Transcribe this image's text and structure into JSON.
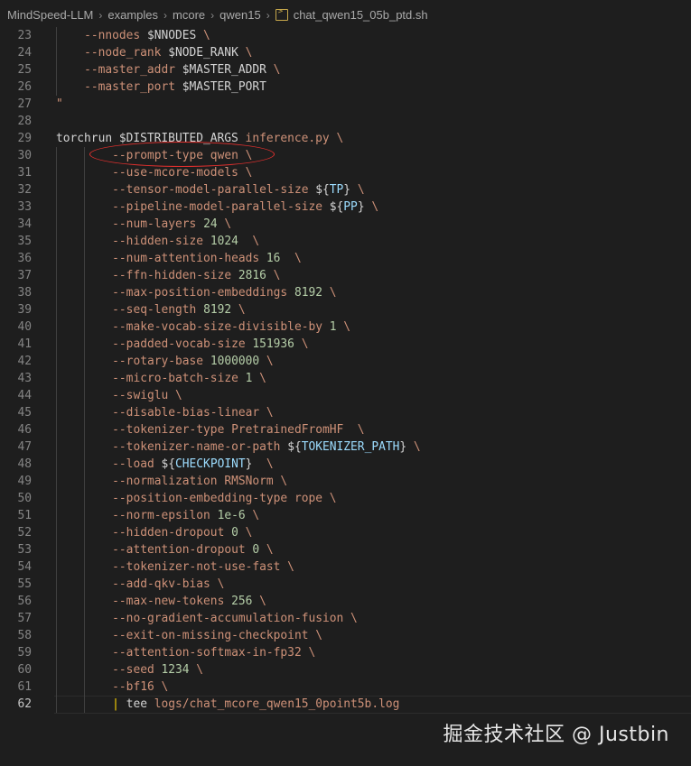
{
  "breadcrumb": {
    "items": [
      "MindSpeed-LLM",
      "examples",
      "mcore",
      "qwen15"
    ],
    "file": "chat_qwen15_05b_ptd.sh"
  },
  "icons": {
    "separator": "chevron-right-icon",
    "file": "terminal-file-icon"
  },
  "colors": {
    "background": "#1e1e1e",
    "text": "#d4d4d4",
    "string": "#ce9178",
    "number": "#b5cea8",
    "variable": "#9cdcfe",
    "annotation_circle": "#e2302e"
  },
  "lines": [
    {
      "n": "23",
      "indent": 1,
      "parts": [
        [
          "--nnodes ",
          "o"
        ],
        [
          "$NNODES",
          "w"
        ],
        [
          " \\",
          "o"
        ]
      ]
    },
    {
      "n": "24",
      "indent": 1,
      "parts": [
        [
          "--node_rank ",
          "o"
        ],
        [
          "$NODE_RANK",
          "w"
        ],
        [
          " \\",
          "o"
        ]
      ]
    },
    {
      "n": "25",
      "indent": 1,
      "parts": [
        [
          "--master_addr ",
          "o"
        ],
        [
          "$MASTER_ADDR",
          "w"
        ],
        [
          " \\",
          "o"
        ]
      ]
    },
    {
      "n": "26",
      "indent": 1,
      "parts": [
        [
          "--master_port ",
          "o"
        ],
        [
          "$MASTER_PORT",
          "w"
        ],
        [
          " ",
          "o"
        ]
      ]
    },
    {
      "n": "27",
      "indent": 0,
      "parts": [
        [
          "\"",
          "o"
        ]
      ]
    },
    {
      "n": "28",
      "indent": 0,
      "parts": []
    },
    {
      "n": "29",
      "indent": 0,
      "parts": [
        [
          "torchrun ",
          "w"
        ],
        [
          "$DISTRIBUTED_ARGS",
          "w"
        ],
        [
          " inference.py \\",
          "o"
        ]
      ]
    },
    {
      "n": "30",
      "indent": 2,
      "parts": [
        [
          "--prompt-type qwen \\",
          "o"
        ]
      ]
    },
    {
      "n": "31",
      "indent": 2,
      "parts": [
        [
          "--use-mcore-models \\",
          "o"
        ]
      ]
    },
    {
      "n": "32",
      "indent": 2,
      "parts": [
        [
          "--tensor-model-parallel-size ",
          "o"
        ],
        [
          "${",
          "w"
        ],
        [
          "TP",
          "v"
        ],
        [
          "}",
          "w"
        ],
        [
          " \\",
          "o"
        ]
      ]
    },
    {
      "n": "33",
      "indent": 2,
      "parts": [
        [
          "--pipeline-model-parallel-size ",
          "o"
        ],
        [
          "${",
          "w"
        ],
        [
          "PP",
          "v"
        ],
        [
          "}",
          "w"
        ],
        [
          " \\",
          "o"
        ]
      ]
    },
    {
      "n": "34",
      "indent": 2,
      "parts": [
        [
          "--num-layers ",
          "o"
        ],
        [
          "24",
          "g"
        ],
        [
          " \\",
          "o"
        ]
      ]
    },
    {
      "n": "35",
      "indent": 2,
      "parts": [
        [
          "--hidden-size ",
          "o"
        ],
        [
          "1024",
          "g"
        ],
        [
          "  \\",
          "o"
        ]
      ]
    },
    {
      "n": "36",
      "indent": 2,
      "parts": [
        [
          "--num-attention-heads ",
          "o"
        ],
        [
          "16",
          "g"
        ],
        [
          "  \\",
          "o"
        ]
      ]
    },
    {
      "n": "37",
      "indent": 2,
      "parts": [
        [
          "--ffn-hidden-size ",
          "o"
        ],
        [
          "2816",
          "g"
        ],
        [
          " \\",
          "o"
        ]
      ]
    },
    {
      "n": "38",
      "indent": 2,
      "parts": [
        [
          "--max-position-embeddings ",
          "o"
        ],
        [
          "8192",
          "g"
        ],
        [
          " \\",
          "o"
        ]
      ]
    },
    {
      "n": "39",
      "indent": 2,
      "parts": [
        [
          "--seq-length ",
          "o"
        ],
        [
          "8192",
          "g"
        ],
        [
          " \\",
          "o"
        ]
      ]
    },
    {
      "n": "40",
      "indent": 2,
      "parts": [
        [
          "--make-vocab-size-divisible-by ",
          "o"
        ],
        [
          "1",
          "g"
        ],
        [
          " \\",
          "o"
        ]
      ]
    },
    {
      "n": "41",
      "indent": 2,
      "parts": [
        [
          "--padded-vocab-size ",
          "o"
        ],
        [
          "151936",
          "g"
        ],
        [
          " \\",
          "o"
        ]
      ]
    },
    {
      "n": "42",
      "indent": 2,
      "parts": [
        [
          "--rotary-base ",
          "o"
        ],
        [
          "1000000",
          "g"
        ],
        [
          " \\",
          "o"
        ]
      ]
    },
    {
      "n": "43",
      "indent": 2,
      "parts": [
        [
          "--micro-batch-size ",
          "o"
        ],
        [
          "1",
          "g"
        ],
        [
          " \\",
          "o"
        ]
      ]
    },
    {
      "n": "44",
      "indent": 2,
      "parts": [
        [
          "--swiglu \\",
          "o"
        ]
      ]
    },
    {
      "n": "45",
      "indent": 2,
      "parts": [
        [
          "--disable-bias-linear \\",
          "o"
        ]
      ]
    },
    {
      "n": "46",
      "indent": 2,
      "parts": [
        [
          "--tokenizer-type PretrainedFromHF  \\",
          "o"
        ]
      ]
    },
    {
      "n": "47",
      "indent": 2,
      "parts": [
        [
          "--tokenizer-name-or-path ",
          "o"
        ],
        [
          "${",
          "w"
        ],
        [
          "TOKENIZER_PATH",
          "v"
        ],
        [
          "}",
          "w"
        ],
        [
          " \\",
          "o"
        ]
      ]
    },
    {
      "n": "48",
      "indent": 2,
      "parts": [
        [
          "--load ",
          "o"
        ],
        [
          "${",
          "w"
        ],
        [
          "CHECKPOINT",
          "v"
        ],
        [
          "}",
          "w"
        ],
        [
          "  \\",
          "o"
        ]
      ]
    },
    {
      "n": "49",
      "indent": 2,
      "parts": [
        [
          "--normalization RMSNorm \\",
          "o"
        ]
      ]
    },
    {
      "n": "50",
      "indent": 2,
      "parts": [
        [
          "--position-embedding-type rope \\",
          "o"
        ]
      ]
    },
    {
      "n": "51",
      "indent": 2,
      "parts": [
        [
          "--norm-epsilon ",
          "o"
        ],
        [
          "1e-6",
          "g"
        ],
        [
          " \\",
          "o"
        ]
      ]
    },
    {
      "n": "52",
      "indent": 2,
      "parts": [
        [
          "--hidden-dropout ",
          "o"
        ],
        [
          "0",
          "g"
        ],
        [
          " \\",
          "o"
        ]
      ]
    },
    {
      "n": "53",
      "indent": 2,
      "parts": [
        [
          "--attention-dropout ",
          "o"
        ],
        [
          "0",
          "g"
        ],
        [
          " \\",
          "o"
        ]
      ]
    },
    {
      "n": "54",
      "indent": 2,
      "parts": [
        [
          "--tokenizer-not-use-fast \\",
          "o"
        ]
      ]
    },
    {
      "n": "55",
      "indent": 2,
      "parts": [
        [
          "--add-qkv-bias \\",
          "o"
        ]
      ]
    },
    {
      "n": "56",
      "indent": 2,
      "parts": [
        [
          "--max-new-tokens ",
          "o"
        ],
        [
          "256",
          "g"
        ],
        [
          " \\",
          "o"
        ]
      ]
    },
    {
      "n": "57",
      "indent": 2,
      "parts": [
        [
          "--no-gradient-accumulation-fusion \\",
          "o"
        ]
      ]
    },
    {
      "n": "58",
      "indent": 2,
      "parts": [
        [
          "--exit-on-missing-checkpoint \\",
          "o"
        ]
      ]
    },
    {
      "n": "59",
      "indent": 2,
      "parts": [
        [
          "--attention-softmax-in-fp32 \\",
          "o"
        ]
      ]
    },
    {
      "n": "60",
      "indent": 2,
      "parts": [
        [
          "--seed ",
          "o"
        ],
        [
          "1234",
          "g"
        ],
        [
          " \\",
          "o"
        ]
      ]
    },
    {
      "n": "61",
      "indent": 2,
      "parts": [
        [
          "--bf16 \\",
          "o"
        ]
      ]
    },
    {
      "n": "62",
      "indent": 2,
      "current": true,
      "parts": [
        [
          "| ",
          "y"
        ],
        [
          "tee ",
          "w"
        ],
        [
          "logs/chat_mcore_qwen15_0point5b.log",
          "o"
        ]
      ]
    }
  ],
  "watermark": "掘金技术社区 @ Justbin"
}
